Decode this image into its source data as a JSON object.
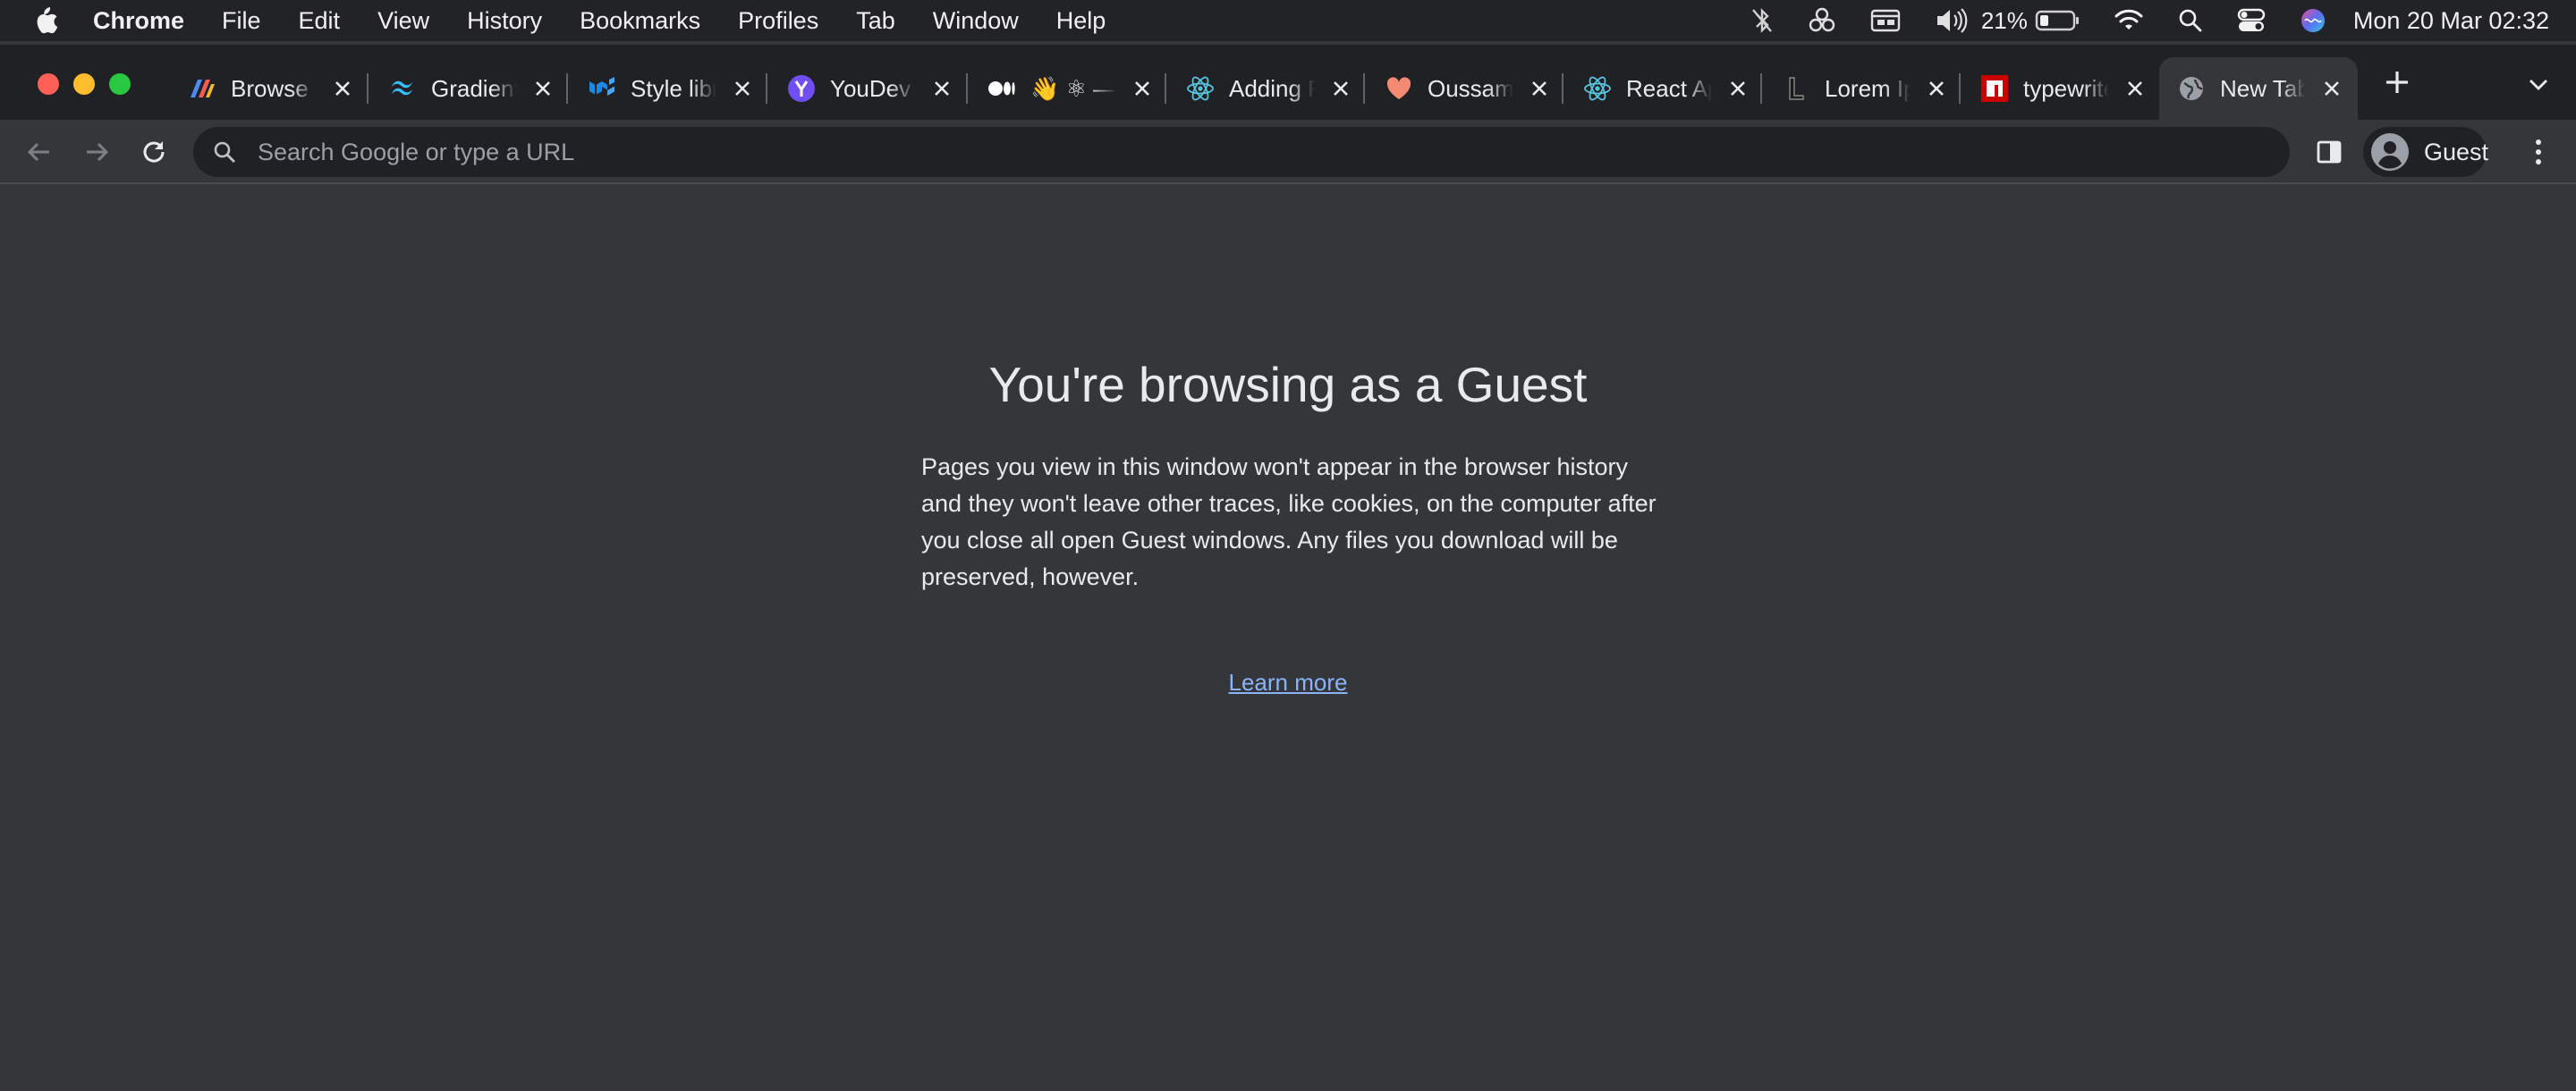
{
  "menubar": {
    "app_name": "Chrome",
    "items": [
      "File",
      "Edit",
      "View",
      "History",
      "Bookmarks",
      "Profiles",
      "Tab",
      "Window",
      "Help"
    ],
    "battery_percent": "21%",
    "clock": "Mon 20 Mar  02:32"
  },
  "tabs": [
    {
      "title": "Browse Free",
      "favicon": "browse-logo-icon"
    },
    {
      "title": "Gradient",
      "favicon": "tailwind-logo-icon"
    },
    {
      "title": "Style library",
      "favicon": "mui-logo-icon"
    },
    {
      "title": "YouDev",
      "favicon": "youdev-logo-icon"
    },
    {
      "title": "👋 ⚛ —",
      "favicon": "medium-logo-icon"
    },
    {
      "title": "Adding React",
      "favicon": "react-logo-icon"
    },
    {
      "title": "Oussama",
      "favicon": "heart-icon"
    },
    {
      "title": "React App",
      "favicon": "react-logo-icon"
    },
    {
      "title": "Lorem Ipsum",
      "favicon": "lorem-logo-icon"
    },
    {
      "title": "typewriter",
      "favicon": "npm-logo-icon"
    },
    {
      "title": "New Tab",
      "favicon": "globe-icon"
    }
  ],
  "toolbar": {
    "omnibox_placeholder": "Search Google or type a URL",
    "profile_label": "Guest"
  },
  "content": {
    "heading": "You're browsing as a Guest",
    "body": "Pages you view in this window won't appear in the browser history and they won't leave other traces, like cookies, on the computer after you close all open Guest windows. Any files you download will be preserved, however.",
    "learn_more": "Learn more"
  },
  "colors": {
    "menubar_bg": "#222326",
    "tabstrip_bg": "#202124",
    "page_bg": "#35363a",
    "link": "#8ab4f8"
  }
}
